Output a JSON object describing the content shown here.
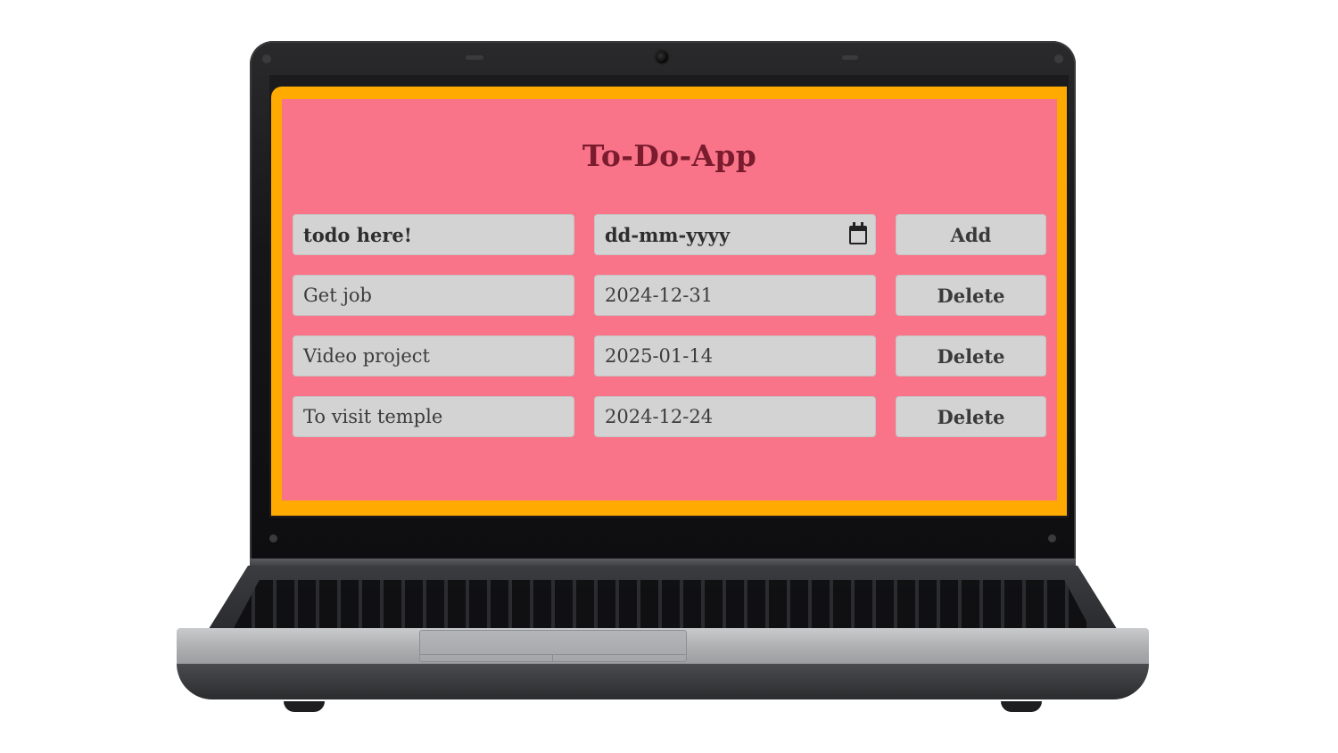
{
  "app": {
    "title": "To-Do-App",
    "new_todo": {
      "placeholder": "todo here!",
      "date_placeholder": "dd-mm-yyyy",
      "add_label": "Add"
    },
    "todos": [
      {
        "name": "Get job",
        "date": "2024-12-31",
        "delete_label": "Delete"
      },
      {
        "name": "Video project",
        "date": "2025-01-14",
        "delete_label": "Delete"
      },
      {
        "name": "To visit temple",
        "date": "2024-12-24",
        "delete_label": "Delete"
      }
    ],
    "colors": {
      "frame": "#ffaa00",
      "background": "#fa7489",
      "field": "#d3d3d3",
      "title": "#7a1c2e"
    }
  },
  "icons": {
    "date_picker": "calendar-icon"
  }
}
